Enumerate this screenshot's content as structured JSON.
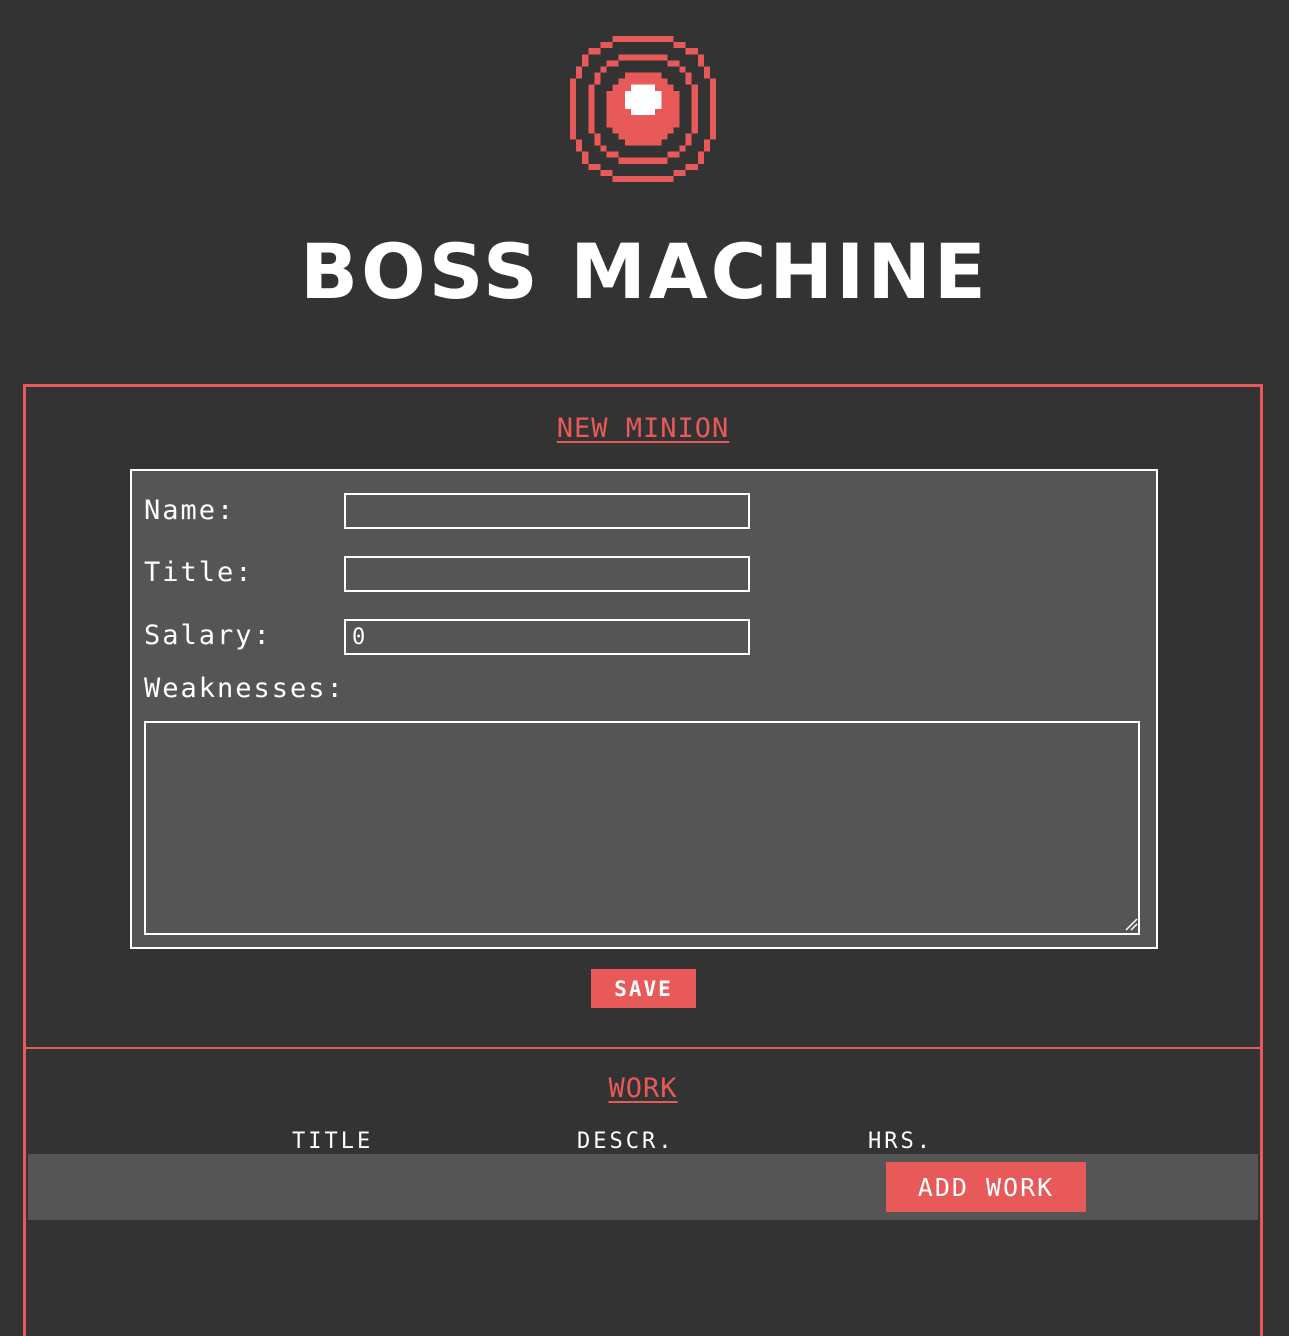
{
  "app": {
    "title": "BOSS MACHINE",
    "logo_icon": "pixel-target-logo-icon"
  },
  "colors": {
    "accent": "#e85a5a",
    "background": "#333333",
    "form_background": "#555555",
    "text": "#ffffff"
  },
  "new_minion": {
    "heading": "NEW MINION",
    "fields": {
      "name_label": "Name:",
      "name_value": "",
      "title_label": "Title:",
      "title_value": "",
      "salary_label": "Salary:",
      "salary_value": "0",
      "weaknesses_label": "Weaknesses:",
      "weaknesses_value": ""
    },
    "save_label": "SAVE"
  },
  "work": {
    "heading": "WORK",
    "columns": [
      "TITLE",
      "DESCR.",
      "HRS."
    ],
    "add_work_label": "ADD WORK"
  }
}
